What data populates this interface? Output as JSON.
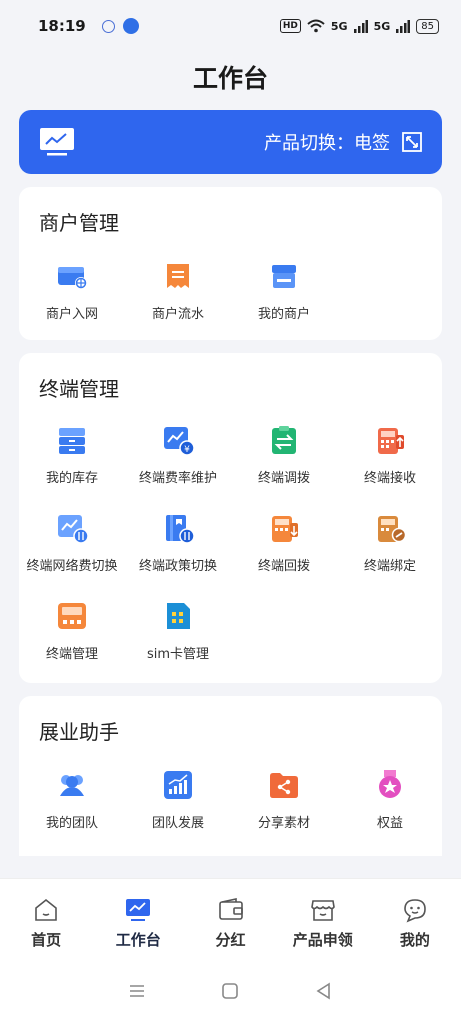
{
  "status": {
    "time": "18:19",
    "hd": "HD",
    "net1": "5G",
    "net2": "5G",
    "battery": "85"
  },
  "page_title": "工作台",
  "banner": {
    "product_switch": "产品切换：电签"
  },
  "merchant": {
    "title": "商户管理",
    "items": [
      {
        "label": "商户入网",
        "icon": "store-globe-icon"
      },
      {
        "label": "商户流水",
        "icon": "receipt-icon"
      },
      {
        "label": "我的商户",
        "icon": "storefront-icon"
      }
    ]
  },
  "terminal": {
    "title": "终端管理",
    "items": [
      {
        "label": "我的库存",
        "icon": "drawer-stack-icon"
      },
      {
        "label": "终端费率维护",
        "icon": "rate-chart-icon"
      },
      {
        "label": "终端调拨",
        "icon": "transfer-clipboard-icon"
      },
      {
        "label": "终端接收",
        "icon": "terminal-receive-icon"
      },
      {
        "label": "终端网络费切换",
        "icon": "network-fee-switch-icon"
      },
      {
        "label": "终端政策切换",
        "icon": "policy-switch-icon"
      },
      {
        "label": "终端回拨",
        "icon": "terminal-return-icon"
      },
      {
        "label": "终端绑定",
        "icon": "terminal-bind-icon"
      },
      {
        "label": "终端管理",
        "icon": "terminal-manage-icon"
      },
      {
        "label": "sim卡管理",
        "icon": "sim-card-icon"
      }
    ]
  },
  "expansion": {
    "title": "展业助手",
    "items": [
      {
        "label": "我的团队",
        "icon": "team-icon"
      },
      {
        "label": "团队发展",
        "icon": "growth-chart-icon"
      },
      {
        "label": "分享素材",
        "icon": "share-folder-icon"
      },
      {
        "label": "权益",
        "icon": "medal-icon"
      }
    ]
  },
  "tabbar": {
    "active": "工作台",
    "items": [
      {
        "label": "首页",
        "icon": "home-icon"
      },
      {
        "label": "工作台",
        "icon": "workbench-icon"
      },
      {
        "label": "分红",
        "icon": "wallet-icon"
      },
      {
        "label": "产品申领",
        "icon": "shop-icon"
      },
      {
        "label": "我的",
        "icon": "chat-face-icon"
      }
    ]
  },
  "colors": {
    "primary": "#2f66ee",
    "background": "#f3f4f8"
  }
}
